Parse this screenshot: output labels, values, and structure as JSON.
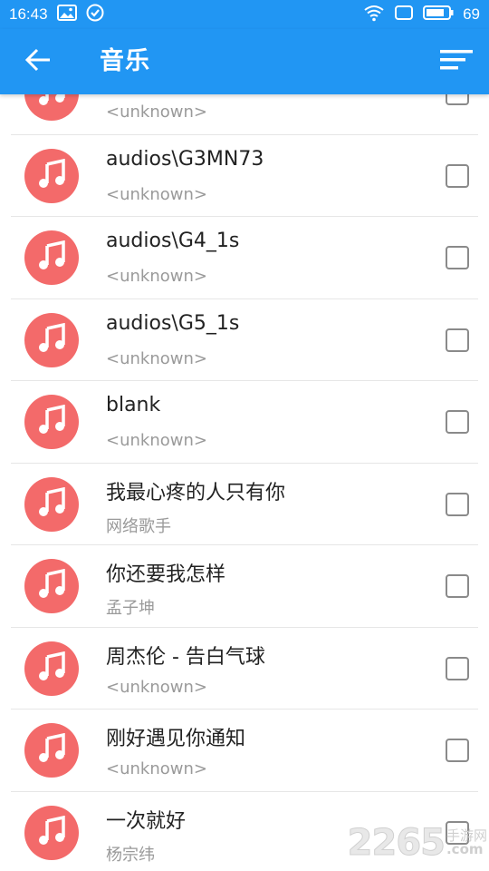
{
  "status_bar": {
    "time": "16:43",
    "battery": "69",
    "icons": [
      "image-icon",
      "check-circle-icon",
      "wifi-icon",
      "screen-icon",
      "battery-icon"
    ]
  },
  "app_bar": {
    "title": "音乐",
    "back_icon": "arrow-left-icon",
    "sort_icon": "sort-lines-icon"
  },
  "songs": [
    {
      "title": "",
      "artist": "<unknown>"
    },
    {
      "title": "audios\\G3MN73",
      "artist": "<unknown>"
    },
    {
      "title": "audios\\G4_1s",
      "artist": "<unknown>"
    },
    {
      "title": "audios\\G5_1s",
      "artist": "<unknown>"
    },
    {
      "title": "blank",
      "artist": "<unknown>"
    },
    {
      "title": "我最心疼的人只有你",
      "artist": "网络歌手"
    },
    {
      "title": "你还要我怎样",
      "artist": "孟子坤"
    },
    {
      "title": "周杰伦 - 告白气球",
      "artist": "<unknown>"
    },
    {
      "title": "刚好遇见你通知",
      "artist": "<unknown>"
    },
    {
      "title": "一次就好",
      "artist": "杨宗纬"
    }
  ],
  "watermark": {
    "number": "2265",
    "site": "手游网",
    "suffix": ".com"
  },
  "colors": {
    "primary": "#2196f3",
    "avatar": "#f36a6a",
    "artist_text": "#9a9a9a"
  }
}
